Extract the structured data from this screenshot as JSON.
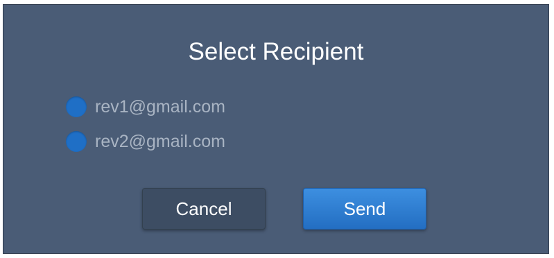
{
  "dialog": {
    "title": "Select Recipient",
    "recipients": [
      {
        "label": "rev1@gmail.com"
      },
      {
        "label": "rev2@gmail.com"
      }
    ],
    "buttons": {
      "cancel_label": "Cancel",
      "send_label": "Send"
    }
  },
  "colors": {
    "dialog_background": "#4a5c76",
    "radio_fill": "#1f6fc6",
    "recipient_text": "#a9b4c3",
    "send_button": "#2c7fd6",
    "cancel_button": "#3d4d63"
  }
}
